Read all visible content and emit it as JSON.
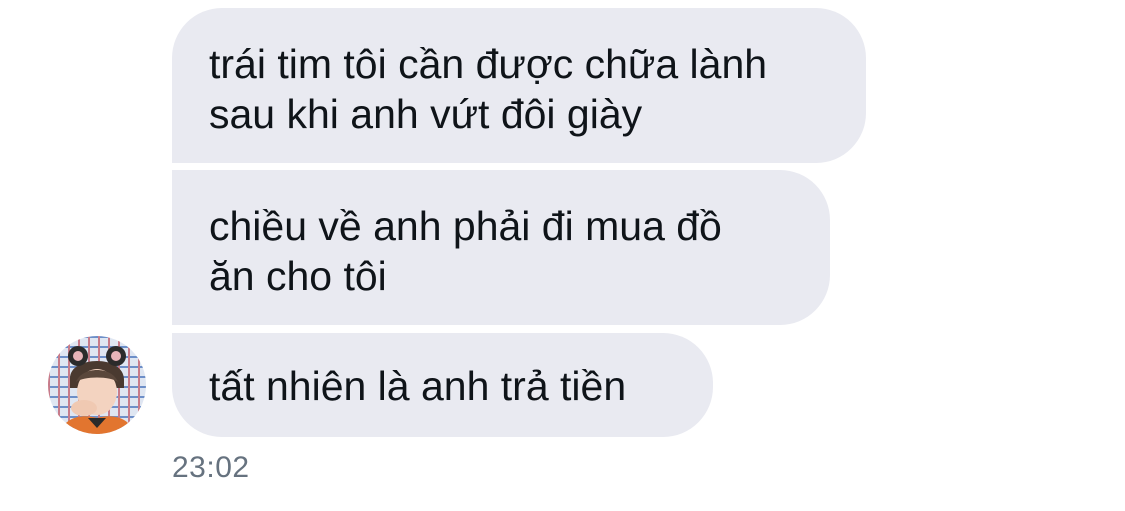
{
  "conversation": {
    "messages": [
      {
        "lines": [
          "trái tim tôi cần được chữa lành",
          "sau khi anh vứt đôi giày"
        ]
      },
      {
        "lines": [
          "chiều về anh phải đi mua đồ",
          "ăn cho tôi"
        ]
      },
      {
        "lines": [
          "tất nhiên là anh trả tiền"
        ]
      }
    ],
    "timestamp": "23:02"
  },
  "colors": {
    "bubble_background": "#e9eaf1",
    "message_text": "#0f1419",
    "timestamp_text": "#66727f"
  }
}
